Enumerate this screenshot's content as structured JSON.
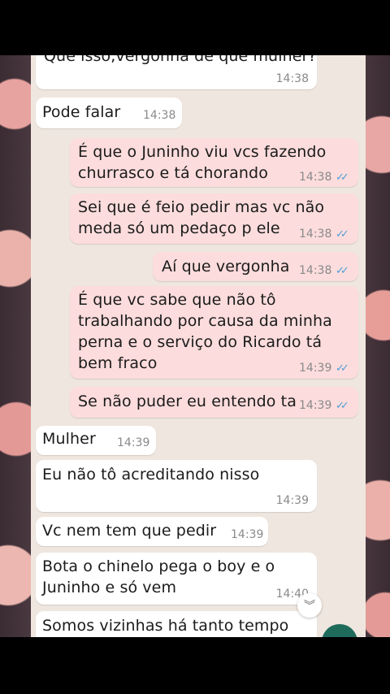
{
  "messages": [
    {
      "dir": "in",
      "text": "Que isso,vergonha de que mulher?",
      "time": "14:38"
    },
    {
      "dir": "in",
      "text": "Pode falar",
      "time": "14:38"
    },
    {
      "dir": "out",
      "text": "É que o Juninho viu vcs fazendo\nchurrasco e tá chorando",
      "time": "14:38"
    },
    {
      "dir": "out",
      "text": "Sei que é feio pedir mas vc não\nmeda só um pedaço p ele",
      "time": "14:38"
    },
    {
      "dir": "out",
      "text": "Aí que vergonha",
      "time": "14:38"
    },
    {
      "dir": "out",
      "text": "É que vc sabe que não tô\ntrabalhando por causa da minha\nperna e o serviço do Ricardo tá\nbem fraco",
      "time": "14:39"
    },
    {
      "dir": "out",
      "text": "Se não puder eu entendo ta",
      "time": "14:39"
    },
    {
      "dir": "in",
      "text": "Mulher",
      "time": "14:39"
    },
    {
      "dir": "in",
      "text": "Eu não tô acreditando nisso",
      "time": "14:39"
    },
    {
      "dir": "in",
      "text": "Vc nem tem que pedir",
      "time": "14:39"
    },
    {
      "dir": "in",
      "text": "Bota o chinelo pega o boy e o\nJuninho e só vem",
      "time": "14:40"
    },
    {
      "dir": "in",
      "text": "Somos vizinhas há tanto tempo",
      "time": ""
    }
  ],
  "read_receipt_icon": "double-check-blue",
  "read_receipt_glyph": "✓✓",
  "scroll_down_glyph": "︾",
  "colors": {
    "incoming": "#ffffff",
    "outgoing": "#fcdcdc",
    "ticks": "#4f9fd9",
    "fab": "#1e6b5c"
  }
}
